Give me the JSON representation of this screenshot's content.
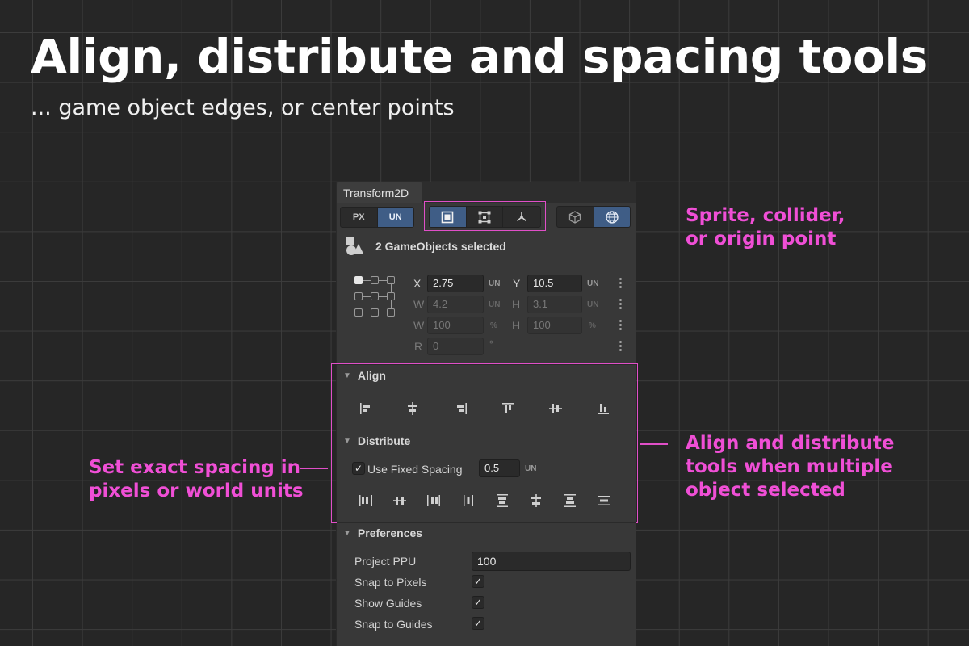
{
  "headline": "Align, distribute and spacing tools",
  "subline": "... game object edges, or center points",
  "panel": {
    "tab_title": "Transform2D",
    "unit_toggle": [
      "PX",
      "UN"
    ],
    "unit_selected": "UN",
    "mode_icons": [
      "sprite-bounds-icon",
      "collider-bounds-icon",
      "origin-point-icon"
    ],
    "mode_selected": "sprite-bounds-icon",
    "space_icons": [
      "local-cube-icon",
      "world-globe-icon"
    ],
    "space_selected": "world-globe-icon",
    "selection_text": "2 GameObjects selected",
    "fields": {
      "x_label": "X",
      "x_value": "2.75",
      "x_unit": "UN",
      "y_label": "Y",
      "y_value": "10.5",
      "y_unit": "UN",
      "w_label": "W",
      "w_value": "4.2",
      "w_unit": "UN",
      "h_label": "H",
      "h_value": "3.1",
      "h_unit": "UN",
      "wp_label": "W",
      "wp_value": "100",
      "wp_unit": "%",
      "hp_label": "H",
      "hp_value": "100",
      "hp_unit": "%",
      "r_label": "R",
      "r_value": "0",
      "r_unit": "°",
      "kebab": "⋮"
    },
    "align": {
      "title": "Align",
      "tools": [
        "align-left-icon",
        "align-center-horizontal-icon",
        "align-right-icon",
        "align-top-icon",
        "align-middle-vertical-icon",
        "align-bottom-icon"
      ]
    },
    "distribute": {
      "title": "Distribute",
      "use_fixed_spacing_label": "Use Fixed Spacing",
      "use_fixed_spacing_checked": true,
      "spacing_value": "0.5",
      "spacing_unit": "UN",
      "tools": [
        "distribute-left-icon",
        "distribute-center-h-icon",
        "distribute-right-icon",
        "distribute-spacing-h-icon",
        "distribute-top-icon",
        "distribute-center-v-icon",
        "distribute-bottom-icon",
        "distribute-spacing-v-icon"
      ]
    },
    "preferences": {
      "title": "Preferences",
      "project_ppu_label": "Project PPU",
      "project_ppu_value": "100",
      "snap_to_pixels_label": "Snap to Pixels",
      "snap_to_pixels_checked": true,
      "show_guides_label": "Show Guides",
      "show_guides_checked": true,
      "snap_to_guides_label": "Snap to Guides",
      "snap_to_guides_checked": true,
      "check_glyph": "✓"
    }
  },
  "callouts": {
    "modes": [
      "Sprite, collider,",
      "or origin point"
    ],
    "align_distribute": [
      "Align and distribute",
      "tools when multiple",
      "object selected"
    ],
    "spacing": [
      "Set exact spacing in",
      "pixels or world units"
    ]
  },
  "colors": {
    "background": "#262626",
    "panel": "#383838",
    "accent_pink": "#f04fd6",
    "selected_blue": "#3f5d86"
  }
}
